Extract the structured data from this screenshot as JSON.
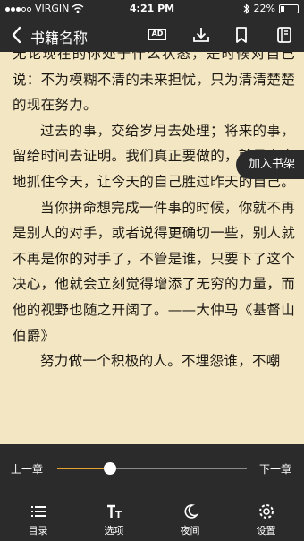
{
  "status_bar": {
    "carrier": "VIRGIN",
    "time": "4:21 PM",
    "battery_percent": "22%",
    "battery_level": 0.22
  },
  "toolbar": {
    "title": "书籍名称",
    "ad_label": "AD"
  },
  "reader": {
    "paragraphs": [
      {
        "indent": false,
        "text": "无论现在的你处于什么状态，是时候对自己说：不为模糊不清的未来担忧，只为清清楚楚的现在努力。"
      },
      {
        "indent": true,
        "text": "过去的事，交给岁月去处理；将来的事，留给时间去证明。我们真正要做的，就是牢牢地抓住今天，让今天的自己胜过昨天的自己。"
      },
      {
        "indent": true,
        "text": "当你拼命想完成一件事的时候，你就不再是别人的对手，或者说得更确切一些，别人就不再是你的对手了，不管是谁，只要下了这个决心，他就会立刻觉得增添了无穷的力量，而他的视野也随之开阔了。——大仲马《基督山伯爵》"
      },
      {
        "indent": true,
        "text": "努力做一个积极的人。不埋怨谁，不嘲"
      }
    ],
    "add_to_shelf": "加入书架"
  },
  "progress": {
    "prev_label": "上一章",
    "next_label": "下一章",
    "value": 0.28,
    "accent": "#e6a12a"
  },
  "bottom_nav": [
    {
      "icon": "list-icon",
      "label": "目录"
    },
    {
      "icon": "font-icon",
      "label": "选项"
    },
    {
      "icon": "moon-icon",
      "label": "夜间"
    },
    {
      "icon": "gear-icon",
      "label": "设置"
    }
  ]
}
